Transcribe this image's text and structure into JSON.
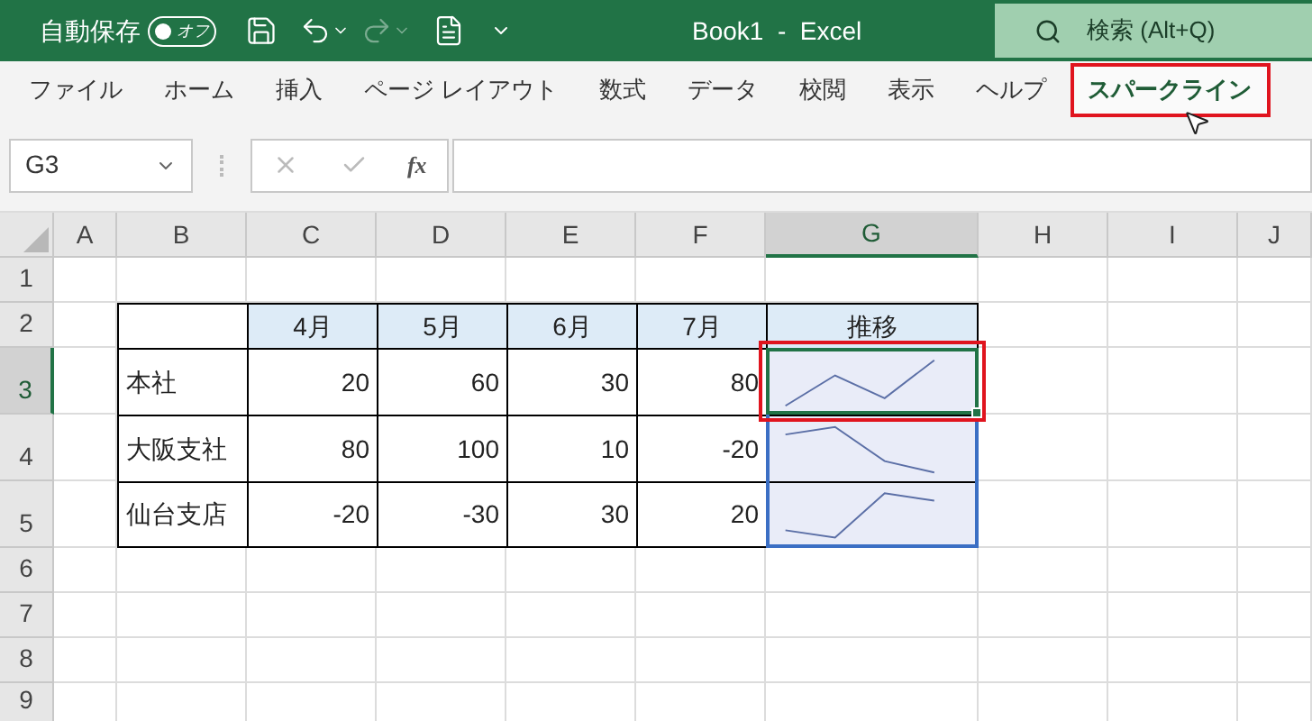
{
  "title_bar": {
    "autosave_label": "自動保存",
    "autosave": {
      "on": false,
      "label": "オフ"
    },
    "title": "Book1  -  Excel",
    "search": {
      "placeholder": "検索 (Alt+Q)"
    }
  },
  "ribbon_tabs": [
    {
      "label": "ファイル",
      "selected": false,
      "highlighted": false
    },
    {
      "label": "ホーム",
      "selected": false,
      "highlighted": false
    },
    {
      "label": "挿入",
      "selected": false,
      "highlighted": false
    },
    {
      "label": "ページ レイアウト",
      "selected": false,
      "highlighted": false
    },
    {
      "label": "数式",
      "selected": false,
      "highlighted": false
    },
    {
      "label": "データ",
      "selected": false,
      "highlighted": false
    },
    {
      "label": "校閲",
      "selected": false,
      "highlighted": false
    },
    {
      "label": "表示",
      "selected": false,
      "highlighted": false
    },
    {
      "label": "ヘルプ",
      "selected": false,
      "highlighted": false
    },
    {
      "label": "スパークライン",
      "selected": true,
      "highlighted": true
    }
  ],
  "formula_bar": {
    "name_box": "G3",
    "function_label": "fx"
  },
  "sheet": {
    "columns": [
      {
        "label": "A",
        "selected": false
      },
      {
        "label": "B",
        "selected": false
      },
      {
        "label": "C",
        "selected": false
      },
      {
        "label": "D",
        "selected": false
      },
      {
        "label": "E",
        "selected": false
      },
      {
        "label": "F",
        "selected": false
      },
      {
        "label": "G",
        "selected": true
      },
      {
        "label": "H",
        "selected": false
      },
      {
        "label": "I",
        "selected": false
      },
      {
        "label": "J",
        "selected": false
      }
    ],
    "rows": [
      {
        "label": "1",
        "selected": false
      },
      {
        "label": "2",
        "selected": false
      },
      {
        "label": "3",
        "selected": true
      },
      {
        "label": "4",
        "selected": false
      },
      {
        "label": "5",
        "selected": false
      },
      {
        "label": "6",
        "selected": false
      },
      {
        "label": "7",
        "selected": false
      },
      {
        "label": "8",
        "selected": false
      },
      {
        "label": "9",
        "selected": false
      }
    ],
    "table": {
      "months": [
        "4月",
        "5月",
        "6月",
        "7月"
      ],
      "trend_header": "推移",
      "rows": [
        {
          "name": "本社",
          "values": [
            "20",
            "60",
            "30",
            "80"
          ],
          "selected": true,
          "highlighted": true
        },
        {
          "name": "大阪支社",
          "values": [
            "80",
            "100",
            "10",
            "-20"
          ],
          "selected": false,
          "highlighted": false
        },
        {
          "name": "仙台支店",
          "values": [
            "-20",
            "-30",
            "30",
            "20"
          ],
          "selected": false,
          "highlighted": false
        }
      ]
    }
  }
}
